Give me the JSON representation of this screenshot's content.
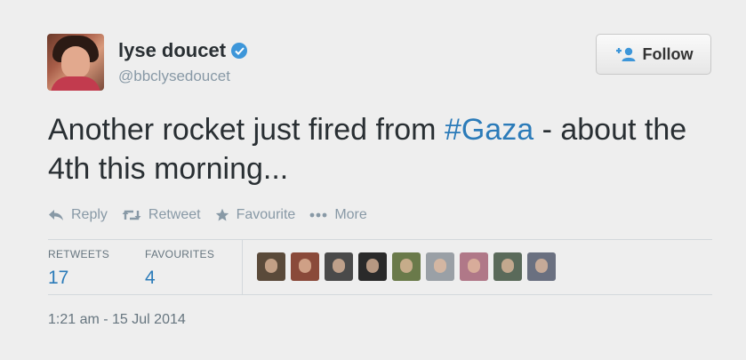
{
  "profile": {
    "name": "lyse doucet",
    "handle": "@bbclysedoucet",
    "verified": true
  },
  "follow_button": {
    "label": "Follow",
    "icon": "add-user-icon"
  },
  "tweet": {
    "text_before": "Another rocket just fired from ",
    "hashtag": "#Gaza",
    "text_after": " - about the 4th this morning..."
  },
  "actions": [
    {
      "label": "Reply",
      "icon": "reply-icon"
    },
    {
      "label": "Retweet",
      "icon": "retweet-icon"
    },
    {
      "label": "Favourite",
      "icon": "star-icon"
    },
    {
      "label": "More",
      "icon": "more-dots-icon"
    }
  ],
  "stats": {
    "retweets_label": "RETWEETS",
    "retweets_value": "17",
    "favourites_label": "FAVOURITES",
    "favourites_value": "4"
  },
  "avatars": [
    {
      "color": "#5a4a3a"
    },
    {
      "color": "#8a4a3a"
    },
    {
      "color": "#4a4a4a"
    },
    {
      "color": "#2a2a2a"
    },
    {
      "color": "#6a7a4a"
    },
    {
      "color": "#9aa0a6"
    },
    {
      "color": "#b07888"
    },
    {
      "color": "#5a6a5a"
    },
    {
      "color": "#6a7080"
    }
  ],
  "timestamp": "1:21 am - 15 Jul 2014",
  "colors": {
    "link": "#2b7bb9",
    "muted": "#8899a6",
    "verified": "#3d96d9",
    "background": "#eeeeee"
  }
}
